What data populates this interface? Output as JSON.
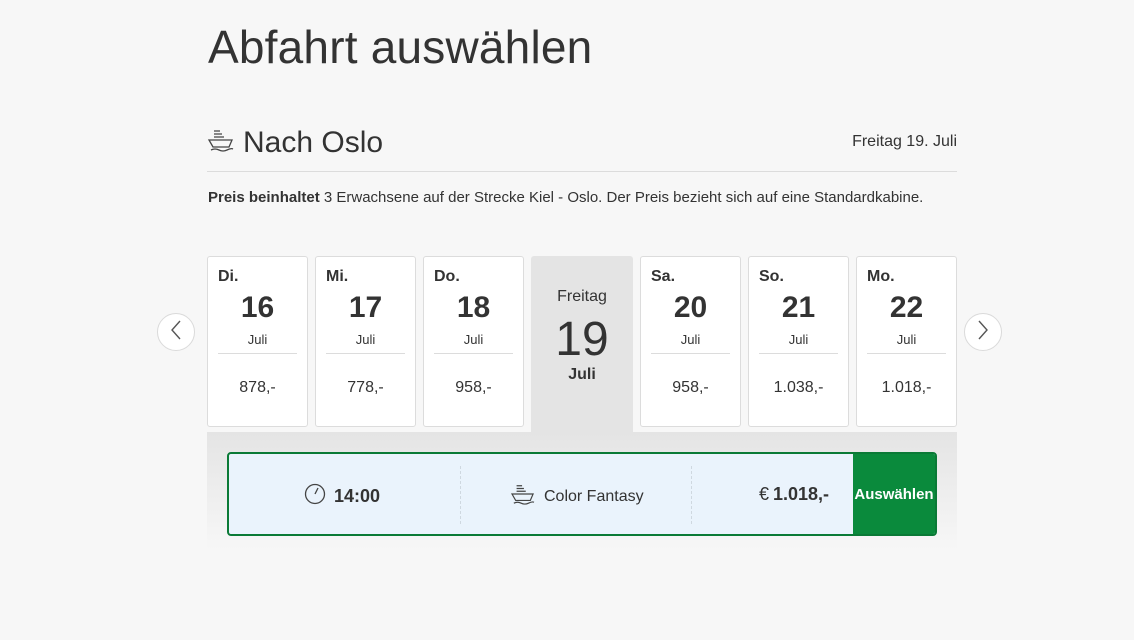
{
  "page": {
    "title": "Abfahrt auswählen"
  },
  "route": {
    "icon": "ship-icon",
    "title": "Nach Oslo",
    "date": "Freitag 19. Juli"
  },
  "price_info": {
    "bold": "Preis beinhaltet",
    "text": " 3 Erwachsene auf der Strecke Kiel - Oslo. Der Preis bezieht sich auf eine Standardkabine."
  },
  "nav": {
    "prev_icon": "chevron-left-icon",
    "next_icon": "chevron-right-icon"
  },
  "days": [
    {
      "dow": "Di.",
      "day": "16",
      "month": "Juli",
      "price": "878,-"
    },
    {
      "dow": "Mi.",
      "day": "17",
      "month": "Juli",
      "price": "778,-"
    },
    {
      "dow": "Do.",
      "day": "18",
      "month": "Juli",
      "price": "958,-"
    },
    {
      "dow": "Sa.",
      "day": "20",
      "month": "Juli",
      "price": "958,-"
    },
    {
      "dow": "So.",
      "day": "21",
      "month": "Juli",
      "price": "1.038,-"
    },
    {
      "dow": "Mo.",
      "day": "22",
      "month": "Juli",
      "price": "1.018,-"
    }
  ],
  "selected_day": {
    "dow": "Freitag",
    "day": "19",
    "month": "Juli"
  },
  "departure": {
    "time_icon": "clock-icon",
    "time": "14:00",
    "ship_icon": "ship-icon",
    "ship": "Color Fantasy",
    "currency": "€",
    "price": "1.018,-",
    "button": "Auswählen"
  },
  "colors": {
    "accent_green": "#0a8a3c",
    "row_border": "#0a7a36",
    "row_bg": "#eaf3fc",
    "selected_bg": "#e4e4e4"
  }
}
